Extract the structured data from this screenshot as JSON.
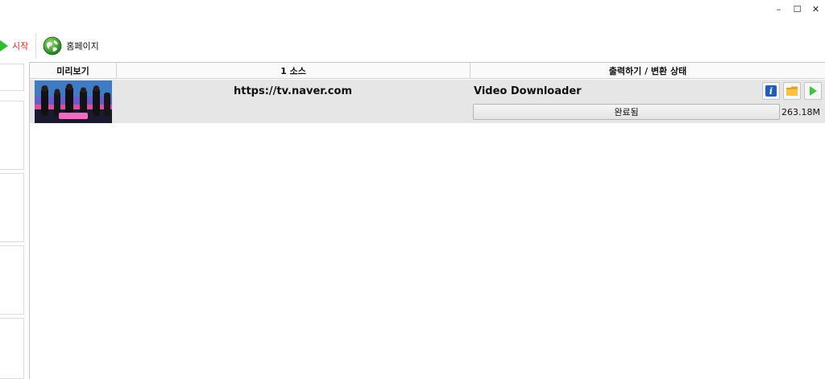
{
  "window_controls": {
    "minimize": "–",
    "maximize": "☐",
    "close": "✕"
  },
  "toolbar": {
    "start_label": "시작",
    "homepage_label": "홈페이지"
  },
  "table": {
    "columns": {
      "preview": "미리보기",
      "source": "1 소스",
      "output": "출력하기 / 변환 상태"
    },
    "rows": [
      {
        "source_url": "https://tv.naver.com",
        "output_name": "Video Downloader",
        "status": "완료됨",
        "size": "263.18M"
      }
    ]
  },
  "colors": {
    "start_accent": "#e02a1f",
    "play_green": "#2ebd2e"
  },
  "icons": [
    "play-icon",
    "globe-icon",
    "info-icon",
    "folder-icon",
    "play-file-icon"
  ]
}
